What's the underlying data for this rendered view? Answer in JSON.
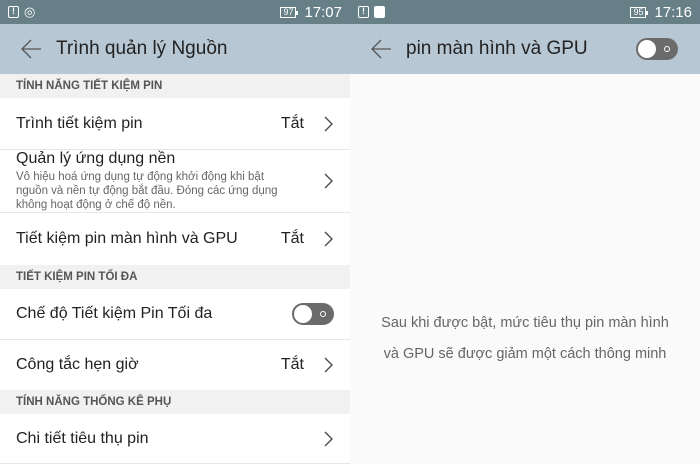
{
  "left": {
    "status": {
      "time": "17:07",
      "battery": "97"
    },
    "header": {
      "title": "Trình quản lý Nguồn"
    },
    "sections": [
      {
        "title": "TÍNH NĂNG TIẾT KIỆM PIN"
      },
      {
        "title": "TIẾT KIỆM PIN TỐI ĐA"
      },
      {
        "title": "TÍNH NĂNG THỐNG KÊ PHỤ"
      }
    ],
    "rows": {
      "power_saver": {
        "label": "Trình tiết kiệm pin",
        "value": "Tắt"
      },
      "background_apps": {
        "label": "Quản lý ứng dụng nền",
        "desc": "Vô hiệu hoá ứng dụng tự động khởi động khi bật nguồn và nền tự động bắt đầu. Đóng các ứng dụng không hoạt động ở chế độ nền."
      },
      "screen_gpu": {
        "label": "Tiết kiệm pin màn hình và GPU",
        "value": "Tắt"
      },
      "ultra_mode": {
        "label": "Chế độ Tiết kiệm Pin Tối đa",
        "enabled": false
      },
      "scheduled": {
        "label": "Công tắc hẹn giờ",
        "value": "Tắt"
      },
      "usage": {
        "label": "Chi tiết tiêu thụ pin"
      }
    }
  },
  "right": {
    "status": {
      "time": "17:16",
      "battery": "95"
    },
    "header": {
      "title": "pin màn hình và GPU",
      "enabled": false
    },
    "message": [
      "Sau khi được bật, mức tiêu thụ pin màn hình",
      "và GPU sẽ được giảm một cách thông minh"
    ]
  }
}
